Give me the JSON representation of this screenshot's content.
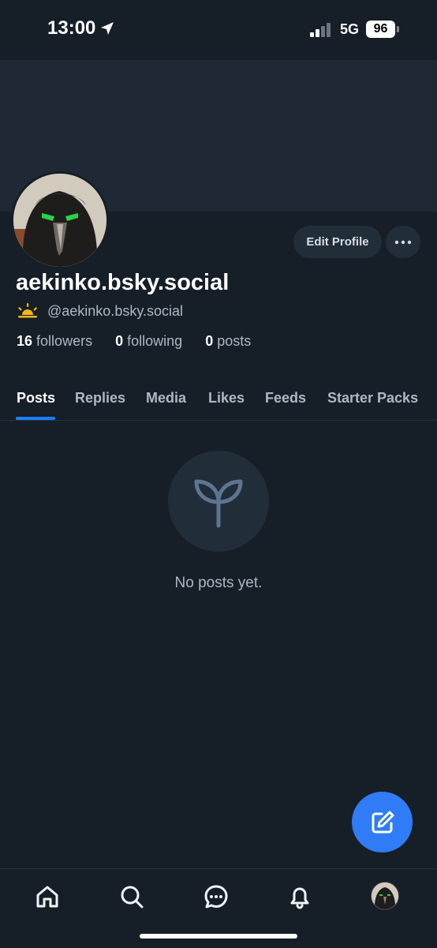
{
  "status": {
    "time": "13:00",
    "network": "5G",
    "battery": "96"
  },
  "profile": {
    "display_name": "aekinko.bsky.social",
    "handle": "@aekinko.bsky.social",
    "followers_count": "16",
    "followers_label": "followers",
    "following_count": "0",
    "following_label": "following",
    "posts_count": "0",
    "posts_label": "posts",
    "edit_label": "Edit Profile"
  },
  "tabs": [
    {
      "label": "Posts",
      "active": true
    },
    {
      "label": "Replies"
    },
    {
      "label": "Media"
    },
    {
      "label": "Likes"
    },
    {
      "label": "Feeds"
    },
    {
      "label": "Starter Packs"
    }
  ],
  "empty_state": {
    "text": "No posts yet.",
    "icon": "sprout-icon"
  },
  "nav": [
    "home-icon",
    "search-icon",
    "chat-icon",
    "bell-icon",
    "profile-avatar"
  ],
  "colors": {
    "background": "#161e27",
    "accent": "#1a7fff",
    "fab": "#2f7cf6",
    "muted": "#aeb8c4"
  }
}
